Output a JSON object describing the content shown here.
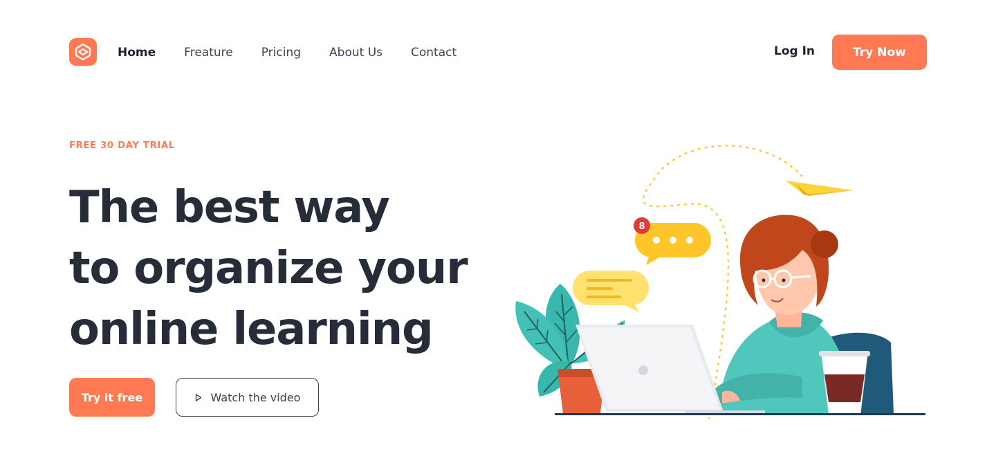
{
  "header": {
    "logo": {
      "icon": "logo-icon",
      "color": "#ff7a52"
    },
    "nav": [
      {
        "label": "Home",
        "active": true
      },
      {
        "label": "Freature",
        "active": false
      },
      {
        "label": "Pricing",
        "active": false
      },
      {
        "label": "About Us",
        "active": false
      },
      {
        "label": "Contact",
        "active": false
      }
    ],
    "login_label": "Log In",
    "cta_label": "Try Now"
  },
  "hero": {
    "eyebrow": "FREE 30 DAY TRIAL",
    "headline_lines": [
      "The best way",
      "to organize your",
      "online learning"
    ],
    "primary_button": "Try it free",
    "secondary_button": "Watch the video",
    "secondary_icon": "play-icon"
  },
  "illustration": {
    "notification_count": "8",
    "accent": "#ff7a52",
    "chat_color": "#ffc629",
    "sweater_color": "#4fc7bd"
  }
}
